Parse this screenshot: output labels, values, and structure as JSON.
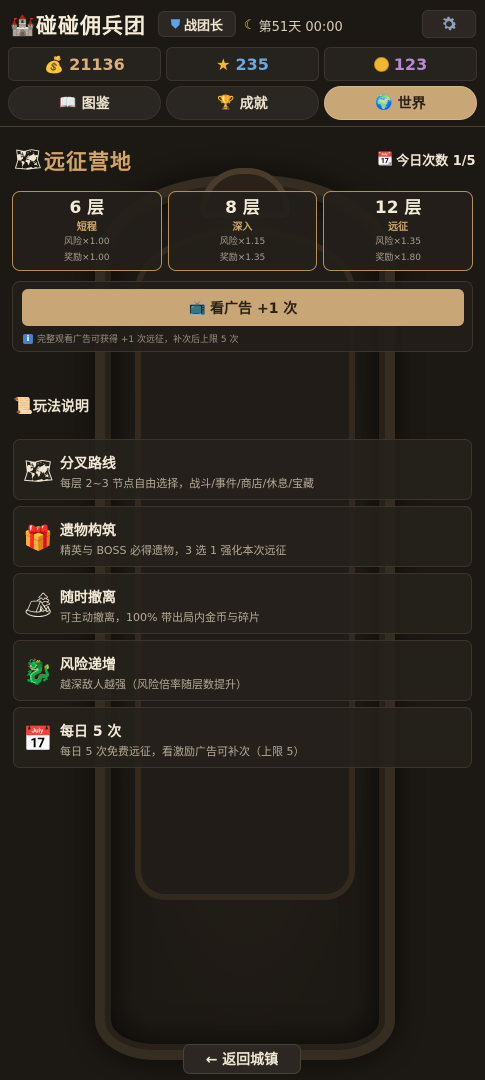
{
  "header": {
    "logo_icon": "castle-icon",
    "title": "碰碰佣兵团",
    "rank": "战团长",
    "day_info": "第51天 00:00",
    "settings_icon": "gear-icon"
  },
  "resources": {
    "gold": "21136",
    "stars": "235",
    "coins": "123"
  },
  "tabs": [
    {
      "label": "图鉴",
      "icon": "book-icon"
    },
    {
      "label": "成就",
      "icon": "trophy-icon"
    },
    {
      "label": "世界",
      "icon": "globe-icon",
      "active": true
    }
  ],
  "expedition": {
    "title": "远征营地",
    "attempts": "今日次数 1/5",
    "depths": [
      {
        "title": "6 层",
        "name": "短程",
        "risk": "风险×1.00",
        "reward": "奖励×1.00"
      },
      {
        "title": "8 层",
        "name": "深入",
        "risk": "风险×1.15",
        "reward": "奖励×1.35"
      },
      {
        "title": "12 层",
        "name": "远征",
        "risk": "风险×1.35",
        "reward": "奖励×1.80"
      }
    ],
    "ad_button": "看广告 +1 次",
    "ad_note": "完整观看广告可获得 +1 次远征，补次后上限 5 次"
  },
  "rules": {
    "title": "玩法说明",
    "items": [
      {
        "icon": "map-icon",
        "title": "分叉路线",
        "desc": "每层 2~3 节点自由选择，战斗/事件/商店/休息/宝藏"
      },
      {
        "icon": "gift-icon",
        "title": "遗物构筑",
        "desc": "精英与 BOSS 必得遗物，3 选 1 强化本次远征"
      },
      {
        "icon": "camp-icon",
        "title": "随时撤离",
        "desc": "可主动撤离，100% 带出局内金币与碎片"
      },
      {
        "icon": "snake-icon",
        "title": "风险递增",
        "desc": "越深敌人越强（风险倍率随层数提升）"
      },
      {
        "icon": "calendar-icon",
        "title": "每日 5 次",
        "desc": "每日 5 次免费远征，看激励广告可补次（上限 5）"
      }
    ]
  },
  "footer": {
    "back": "← 返回城镇"
  }
}
